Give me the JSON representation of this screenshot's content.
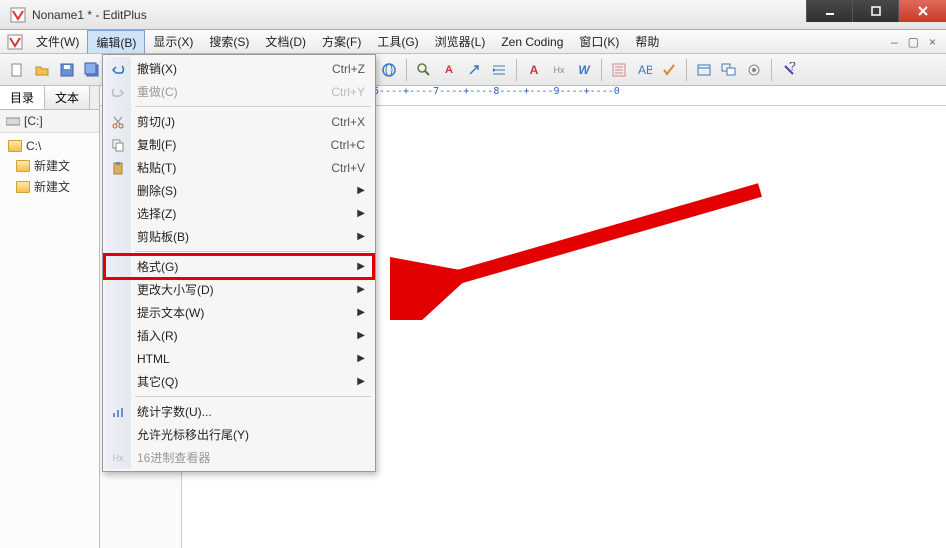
{
  "title": "Noname1 * - EditPlus",
  "menubar": {
    "items": [
      "文件(W)",
      "编辑(B)",
      "显示(X)",
      "搜索(S)",
      "文档(D)",
      "方案(F)",
      "工具(G)",
      "浏览器(L)",
      "Zen Coding",
      "窗口(K)",
      "帮助"
    ],
    "open_index": 1
  },
  "sidebar": {
    "tabs": [
      "目录",
      "文本"
    ],
    "active_tab": 0,
    "drive": "[C:]",
    "root": "C:\\",
    "folders": [
      "新建文",
      "新建文"
    ]
  },
  "ruler_text": "+----2----+----3----+----4----+----5----+----6----+----7----+----8----+----9----+----0",
  "dropdown": [
    {
      "icon": "undo-icon",
      "label": "撤销(X)",
      "shortcut": "Ctrl+Z"
    },
    {
      "icon": "redo-icon",
      "label": "重做(C)",
      "shortcut": "Ctrl+Y",
      "disabled": true
    },
    {
      "sep": true
    },
    {
      "icon": "cut-icon",
      "label": "剪切(J)"
    },
    {
      "icon": "copy-icon",
      "label": "复制(F)",
      "shortcut": "Ctrl+C"
    },
    {
      "icon": "paste-icon",
      "label": "粘贴(T)",
      "shortcut": "Ctrl+V"
    },
    {
      "label": "删除(S)",
      "submenu": true
    },
    {
      "label": "选择(Z)",
      "submenu": true
    },
    {
      "label": "剪贴板(B)",
      "submenu": true
    },
    {
      "sep": true
    },
    {
      "label": "格式(G)",
      "submenu": true,
      "highlighted": true
    },
    {
      "label": "更改大小写(D)",
      "submenu": true
    },
    {
      "label": "提示文本(W)",
      "submenu": true
    },
    {
      "label": "插入(R)",
      "submenu": true
    },
    {
      "label": "HTML",
      "submenu": true
    },
    {
      "label": "其它(Q)",
      "submenu": true
    },
    {
      "sep": true
    },
    {
      "icon": "stats-icon",
      "label": "统计字数(U)..."
    },
    {
      "label": "允许光标移出行尾(Y)"
    },
    {
      "icon": "hex-icon",
      "label": "16进制查看器",
      "disabled": true
    }
  ],
  "cut_shortcut": "Ctrl+X"
}
